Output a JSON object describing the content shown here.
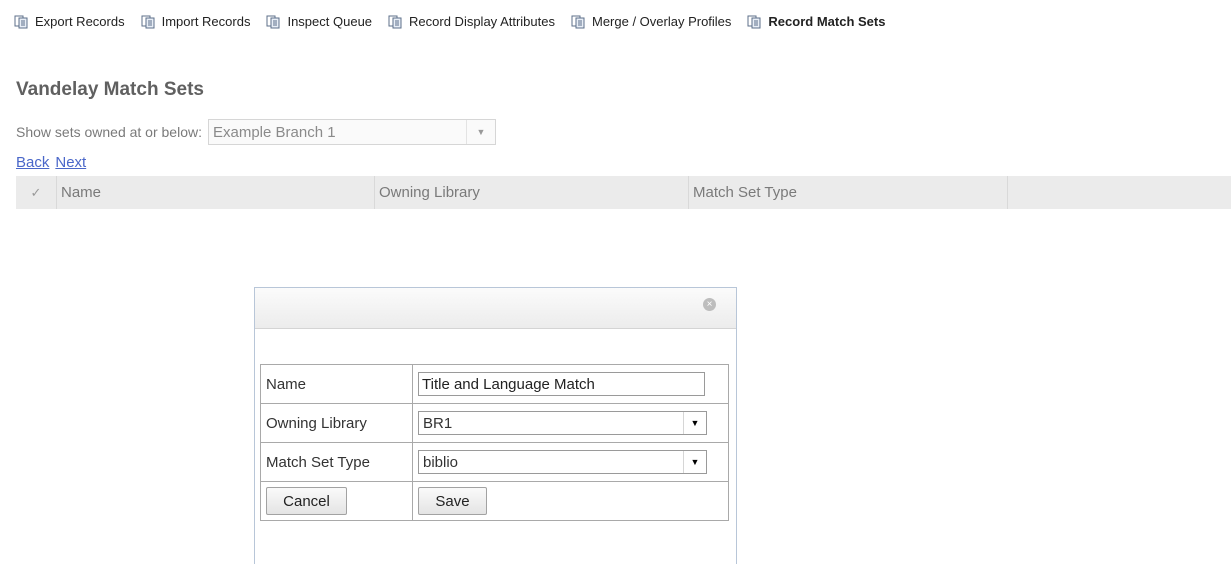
{
  "toolbar": {
    "items": [
      {
        "label": "Export Records",
        "icon": "page-copy-icon"
      },
      {
        "label": "Import Records",
        "icon": "page-copy-icon"
      },
      {
        "label": "Inspect Queue",
        "icon": "page-copy-icon"
      },
      {
        "label": "Record Display Attributes",
        "icon": "page-copy-icon"
      },
      {
        "label": "Merge / Overlay Profiles",
        "icon": "page-copy-icon"
      },
      {
        "label": "Record Match Sets",
        "icon": "page-copy-icon",
        "active": true
      }
    ]
  },
  "page": {
    "title": "Vandelay Match Sets",
    "filter_label": "Show sets owned at or below:",
    "filter_value": "Example Branch 1"
  },
  "pager": {
    "back": "Back",
    "next": "Next"
  },
  "grid": {
    "check_symbol": "✓",
    "columns": [
      "Name",
      "Owning Library",
      "Match Set Type"
    ]
  },
  "dialog": {
    "close_symbol": "×",
    "fields": {
      "name_label": "Name",
      "name_value": "Title and Language Match",
      "owning_library_label": "Owning Library",
      "owning_library_value": "BR1",
      "match_set_type_label": "Match Set Type",
      "match_set_type_value": "biblio"
    },
    "cancel_label": "Cancel",
    "save_label": "Save"
  }
}
